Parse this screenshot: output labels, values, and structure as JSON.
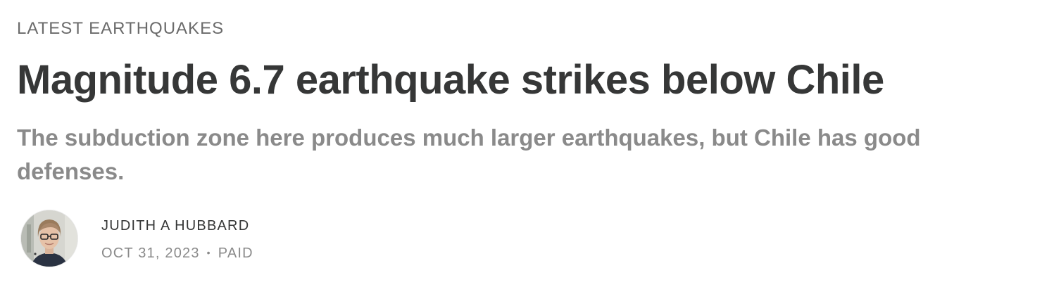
{
  "post": {
    "section": "Latest Earthquakes",
    "title": "Magnitude 6.7 earthquake strikes below Chile",
    "subtitle": "The subduction zone here produces much larger earthquakes, but Chile has good defenses."
  },
  "byline": {
    "author": "Judith A Hubbard",
    "date": "OCT 31, 2023",
    "separator": "•",
    "access": "PAID",
    "avatar_icon": "author-avatar"
  },
  "colors": {
    "title": "#363737",
    "muted": "#8a8a8a",
    "label": "#6b6b6b"
  }
}
